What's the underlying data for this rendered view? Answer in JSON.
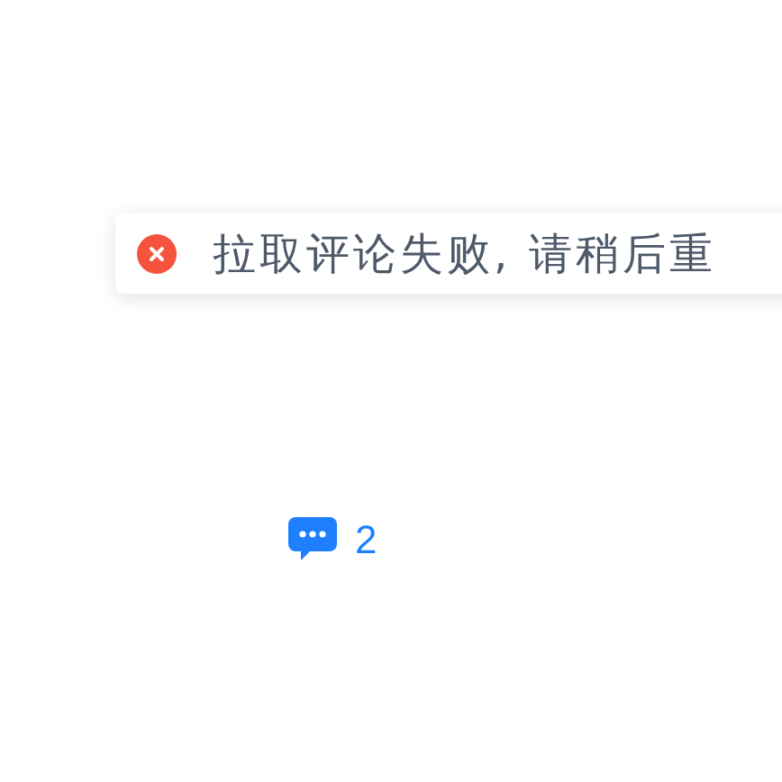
{
  "toast": {
    "kind": "error",
    "message": "拉取评论失败, 请稍后重"
  },
  "comments": {
    "count": "2"
  }
}
